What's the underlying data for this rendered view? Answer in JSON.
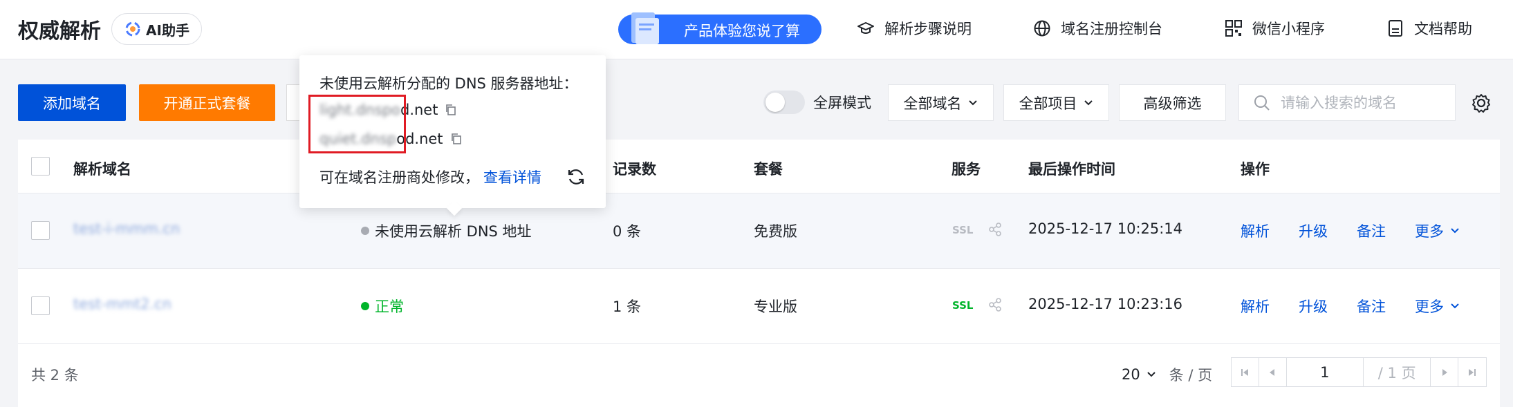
{
  "header": {
    "title": "权威解析",
    "ai_button": "AI助手",
    "promo": "产品体验您说了算",
    "nav": [
      {
        "label": "解析步骤说明",
        "icon": "graduation-cap-icon"
      },
      {
        "label": "域名注册控制台",
        "icon": "globe-icon"
      },
      {
        "label": "微信小程序",
        "icon": "qrcode-icon"
      },
      {
        "label": "文档帮助",
        "icon": "document-icon"
      }
    ]
  },
  "toolbar": {
    "add_domain": "添加域名",
    "open_plan": "开通正式套餐",
    "fullscreen": "全屏模式",
    "filter_domains": "全部域名",
    "filter_projects": "全部项目",
    "advanced_filter": "高级筛选",
    "search_placeholder": "请输入搜索的域名"
  },
  "table": {
    "columns": [
      "解析域名",
      "记录数",
      "套餐",
      "服务",
      "最后操作时间",
      "操作"
    ],
    "rows": [
      {
        "domain": "test-i-mmm.cn",
        "status": "未使用云解析 DNS 地址",
        "status_type": "inactive",
        "records": "0 条",
        "plan": "免费版",
        "ssl": "SSL",
        "ssl_active": false,
        "time": "2025-12-17 10:25:14"
      },
      {
        "domain": "test-mmt2.cn",
        "status": "正常",
        "status_type": "normal",
        "records": "1 条",
        "plan": "专业版",
        "ssl": "SSL",
        "ssl_active": true,
        "time": "2025-12-17 10:23:16"
      }
    ],
    "actions": {
      "resolve": "解析",
      "upgrade": "升级",
      "note": "备注",
      "more": "更多"
    }
  },
  "footer": {
    "total": "共 2 条",
    "page_size": "20",
    "page_size_unit": "条 / 页",
    "current_page": "1",
    "total_pages": "/ 1 页"
  },
  "popover": {
    "title": "未使用云解析分配的 DNS 服务器地址：",
    "dns_servers": [
      {
        "hidden": "light.dnspo",
        "suffix": "d.net"
      },
      {
        "hidden": "quiet.dnsp",
        "suffix": "od.net"
      }
    ],
    "footer_text": "可在域名注册商处修改，",
    "footer_link": "查看详情"
  },
  "colors": {
    "primary": "#0052d9",
    "orange": "#ff7a00",
    "promo": "#2b6fff",
    "success": "#00b42a",
    "inactive_dot": "#a8abb2",
    "highlight": "#e01b24"
  }
}
